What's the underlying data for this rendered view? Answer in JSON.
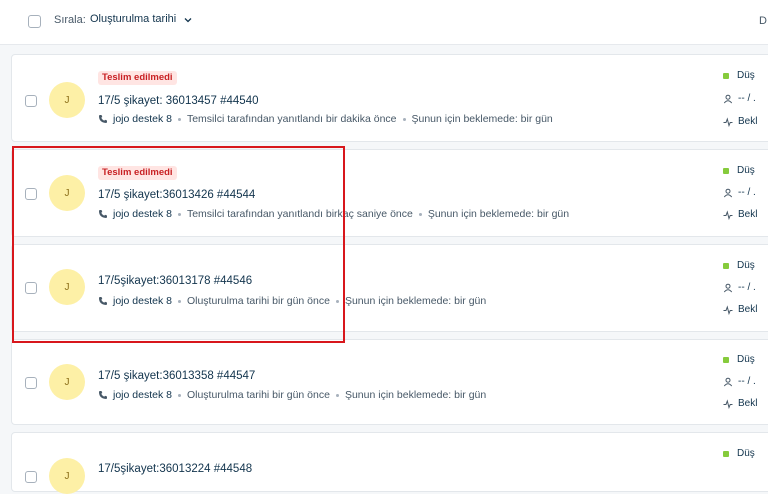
{
  "toolbar": {
    "sort_label": "Sırala:",
    "sort_value": "Oluşturulma tarihi",
    "right_text": "D"
  },
  "tickets": [
    {
      "status_badge": "Teslim edilmedi",
      "subject": "17/5 şikayet: 36013457 #44540",
      "agent": "jojo destek 8",
      "activity": "Temsilci tarafından yanıtlandı bir dakika önce",
      "waiting": "Şunun için beklemede: bir gün",
      "avatar_initial": "J",
      "priority": "Düş",
      "assignee": "-- / .",
      "state": "Bekl"
    },
    {
      "status_badge": "Teslim edilmedi",
      "subject": "17/5 şikayet:36013426 #44544",
      "agent": "jojo destek 8",
      "activity": "Temsilci tarafından yanıtlandı birkaç saniye önce",
      "waiting": "Şunun için beklemede: bir gün",
      "avatar_initial": "J",
      "priority": "Düş",
      "assignee": "-- / .",
      "state": "Bekl"
    },
    {
      "status_badge": "",
      "subject": "17/5şikayet:36013178 #44546",
      "agent": "jojo destek 8",
      "activity": "Oluşturulma tarihi bir gün önce",
      "waiting": "Şunun için beklemede: bir gün",
      "avatar_initial": "J",
      "priority": "Düş",
      "assignee": "-- / .",
      "state": "Bekl"
    },
    {
      "status_badge": "",
      "subject": "17/5 şikayet:36013358 #44547",
      "agent": "jojo destek 8",
      "activity": "Oluşturulma tarihi bir gün önce",
      "waiting": "Şunun için beklemede: bir gün",
      "avatar_initial": "J",
      "priority": "Düş",
      "assignee": "-- / .",
      "state": "Bekl"
    },
    {
      "status_badge": "",
      "subject": "17/5şikayet:36013224 #44548",
      "agent": "",
      "activity": "",
      "waiting": "",
      "avatar_initial": "J",
      "priority": "Düş",
      "assignee": "",
      "state": ""
    }
  ],
  "colors": {
    "badge_bg": "#ffe5e3",
    "badge_text": "#c82124",
    "avatar_bg": "#fdf0a6",
    "priority_low": "#86cb3c",
    "highlight": "#d8171c"
  }
}
